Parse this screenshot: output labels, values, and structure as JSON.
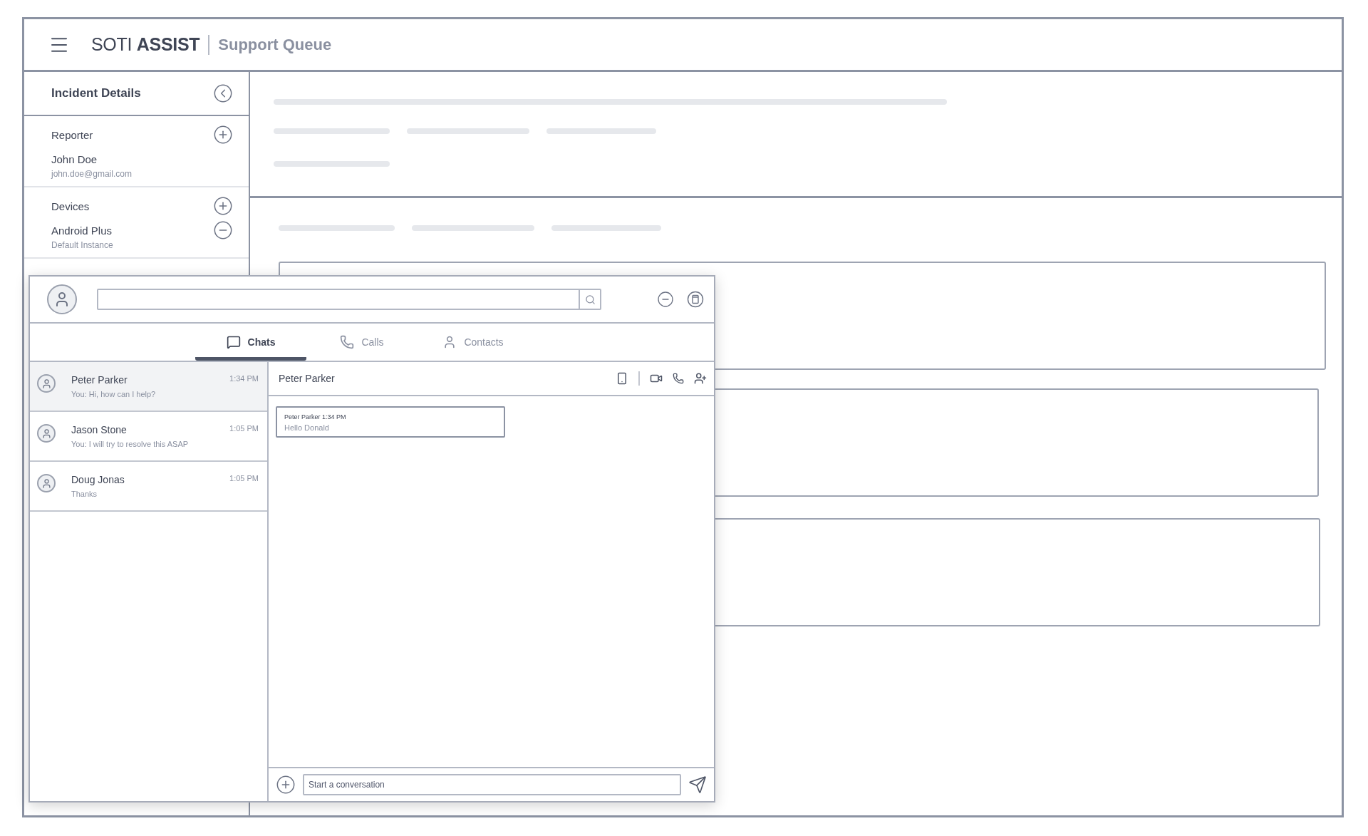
{
  "app": {
    "brand": "SOTI **ASSIST**",
    "page_title": "Support Queue"
  },
  "incident_panel": {
    "title": "Incident Details",
    "sections": [
      {
        "heading": "Reporter",
        "entries": [
          {
            "name": "John Doe",
            "detail": "john.doe@gmail.com",
            "removable": false
          }
        ]
      },
      {
        "heading": "Devices",
        "entries": [
          {
            "name": "Android Plus",
            "detail": "Default Instance",
            "removable": true
          }
        ]
      }
    ]
  },
  "chat": {
    "tabs": [
      {
        "label": "Chats",
        "kind": "chats",
        "selected": true
      },
      {
        "label": "Calls",
        "kind": "calls",
        "selected": false
      },
      {
        "label": "Contacts",
        "kind": "contacts",
        "selected": false
      }
    ],
    "conversations": [
      {
        "name": "Peter Parker",
        "time": "1:34 PM",
        "preview": "You: Hi, how can I help?",
        "selected": true
      },
      {
        "name": "Jason Stone",
        "time": "1:05 PM",
        "preview": "You: I will try to resolve this ASAP",
        "selected": false
      },
      {
        "name": "Doug Jonas",
        "time": "1:05 PM",
        "preview": "Thanks",
        "selected": false
      }
    ],
    "active": {
      "name": "Peter Parker",
      "messages": [
        {
          "meta": "Peter Parker 1:34 PM",
          "text": "Hello Donald"
        }
      ]
    },
    "composer": {
      "placeholder": "Start a conversation"
    }
  }
}
